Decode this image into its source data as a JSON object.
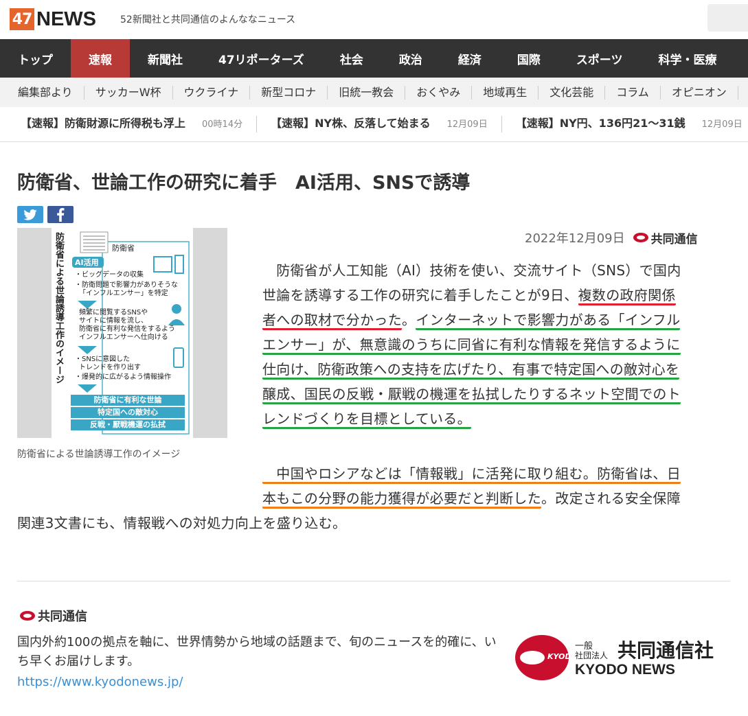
{
  "header": {
    "logo_num": "47",
    "logo_word": "NEWS",
    "tagline": "52新聞社と共同通信のよんななニュース"
  },
  "main_nav": [
    "トップ",
    "速報",
    "新聞社",
    "47リポーターズ",
    "社会",
    "政治",
    "経済",
    "国際",
    "スポーツ",
    "科学・医療"
  ],
  "main_nav_active": "速報",
  "sub_nav": [
    "編集部より",
    "サッカーW杯",
    "ウクライナ",
    "新型コロナ",
    "旧統一教会",
    "おくやみ",
    "地域再生",
    "文化芸能",
    "コラム",
    "オピニオン"
  ],
  "ticker": [
    {
      "headline": "【速報】防衛財源に所得税も浮上",
      "time": "00時14分"
    },
    {
      "headline": "【速報】NY株、反落して始まる",
      "time": "12月09日"
    },
    {
      "headline": "【速報】NY円、136円21～31銭",
      "time": "12月09日"
    }
  ],
  "article": {
    "title": "防衛省、世論工作の研究に着手　AI活用、SNSで誘導",
    "date": "2022年12月09日",
    "source": "共同通信",
    "image_caption": "防衛省による世論誘導工作のイメージ",
    "figure": {
      "vertical_title": "防衛省による世論誘導工作のイメージ",
      "org": "防衛省",
      "ai_badge": "AI活用",
      "steps": [
        "・ビッグデータの収集",
        "・防衛問題で影響力がありそうな",
        "「インフルエンサー」を特定",
        "頻繁に閲覧するSNSや",
        "サイトに情報を流し、",
        "防衛省に有利な発信をするよう",
        "インフルエンサーへ仕向ける",
        "・SNSに意図した",
        "トレンドを作り出す",
        "・爆発的に広がるよう情報操作"
      ],
      "outcomes": [
        "防衛省に有利な世論",
        "特定国への敵対心",
        "反戦・厭戦機運の払拭"
      ]
    },
    "p1": [
      [
        {
          "t": "　防衛省が人工知能（AI）技術を使い、交流サイト（SNS）で国内",
          "u": ""
        }
      ],
      [
        {
          "t": "世論を誘導する工作の研究に着手したことが9日、",
          "u": ""
        },
        {
          "t": "複数の政府関係",
          "u": "red"
        }
      ],
      [
        {
          "t": "者への取材で分かった",
          "u": "red"
        },
        {
          "t": "。",
          "u": ""
        },
        {
          "t": "インターネットで影響力がある「インフル",
          "u": "green"
        }
      ],
      [
        {
          "t": "エンサー」が、無意識のうちに同省に有利な情報を発信するように",
          "u": "green"
        }
      ],
      [
        {
          "t": "仕向け、防衛政策への支持を広げたり、有事で特定国への敵対心を",
          "u": "green"
        }
      ],
      [
        {
          "t": "醸成、国民の反戦・厭戦の機運を払拭したりするネット空間でのト",
          "u": "green"
        }
      ],
      [
        {
          "t": "レンドづくりを目標としている。",
          "u": "green"
        }
      ]
    ],
    "p2": [
      [
        {
          "t": "",
          "u": "",
          "pad": 357
        },
        {
          "t": "　中国やロシアなどは「情報戦」に活発に取り組む。防衛省は、日",
          "u": "orange"
        }
      ],
      [
        {
          "t": "",
          "u": "",
          "pad": 357
        },
        {
          "t": "本もこの分野の能力獲得が必要だと判断した",
          "u": "orange"
        },
        {
          "t": "。改定される安全保障",
          "u": ""
        }
      ],
      [
        {
          "t": "関連3文書にも、情報戦への対処力向上を盛り込む。",
          "u": ""
        }
      ]
    ]
  },
  "footer": {
    "source": "共同通信",
    "description": "国内外約100の拠点を軸に、世界情勢から地域の話題まで、旬のニュースを的確に、いち早くお届けします。",
    "link": "https://www.kyodonews.jp/",
    "logo_small_1": "一般",
    "logo_small_2": "社団法人",
    "logo_jp": "共同通信社",
    "logo_en": "KYODO NEWS",
    "logo_mark": "KYODO"
  },
  "colors": {
    "logo_orange": "#e4642b",
    "nav_bg": "#333333",
    "nav_active": "#b73a36",
    "underline_red": "#e02030",
    "underline_green": "#24a543",
    "underline_orange": "#f07d16",
    "link_blue": "#3b8fd0",
    "kyodo_red": "#c8102e"
  }
}
